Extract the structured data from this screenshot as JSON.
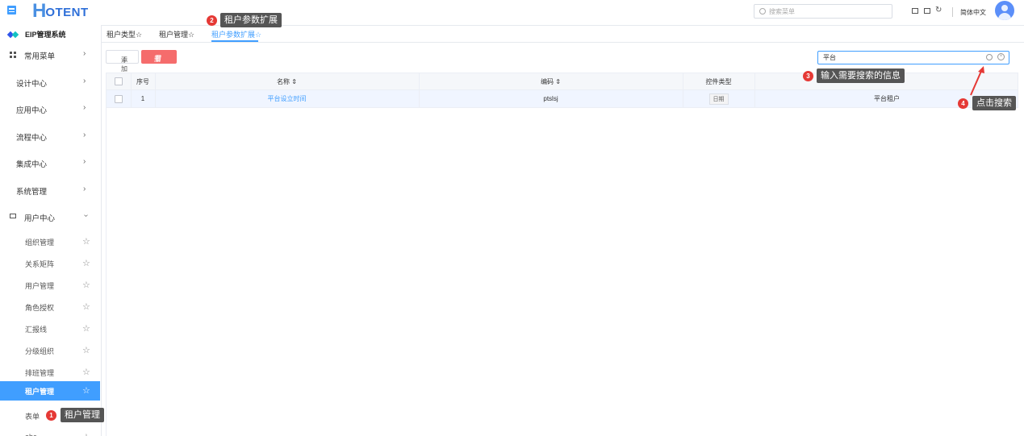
{
  "header": {
    "logo_letter": "H",
    "logo_text": "OTENT",
    "search_placeholder": "搜索菜单",
    "language": "简体中文"
  },
  "sidebar": {
    "system_title": "EIP管理系统",
    "items": [
      {
        "label": "常用菜单"
      },
      {
        "label": "设计中心"
      },
      {
        "label": "应用中心"
      },
      {
        "label": "流程中心"
      },
      {
        "label": "集成中心"
      },
      {
        "label": "系统管理"
      },
      {
        "label": "用户中心"
      }
    ],
    "sub_items": [
      {
        "label": "组织管理"
      },
      {
        "label": "关系矩阵"
      },
      {
        "label": "用户管理"
      },
      {
        "label": "角色授权"
      },
      {
        "label": "汇报线"
      },
      {
        "label": "分级组织"
      },
      {
        "label": "排班管理"
      },
      {
        "label": "租户管理"
      },
      {
        "label": "表单"
      },
      {
        "label": "abc"
      }
    ]
  },
  "tabs": [
    {
      "label": "租户类型☆"
    },
    {
      "label": "租户管理☆"
    },
    {
      "label": "租户参数扩展☆"
    }
  ],
  "toolbar": {
    "add_label": "添加",
    "delete_label": "删除",
    "search_value": "平台"
  },
  "table": {
    "columns": [
      "序号",
      "名称 ⇕",
      "编码 ⇕",
      "控件类型",
      ""
    ],
    "rows": [
      {
        "index": "1",
        "name": "平台设立时间",
        "code": "ptslsj",
        "control_type": "日期",
        "tenant": "平台租户"
      }
    ]
  },
  "annotations": {
    "a1": {
      "num": "1",
      "text": "租户管理"
    },
    "a2": {
      "num": "2",
      "text": "租户参数扩展"
    },
    "a3": {
      "num": "3",
      "text": "输入需要搜索的信息"
    },
    "a4": {
      "num": "4",
      "text": "点击搜索"
    }
  },
  "colors": {
    "accent": "#409eff",
    "danger": "#f56c6c",
    "annotation_dot": "#e53935",
    "tooltip_bg": "#555555"
  }
}
